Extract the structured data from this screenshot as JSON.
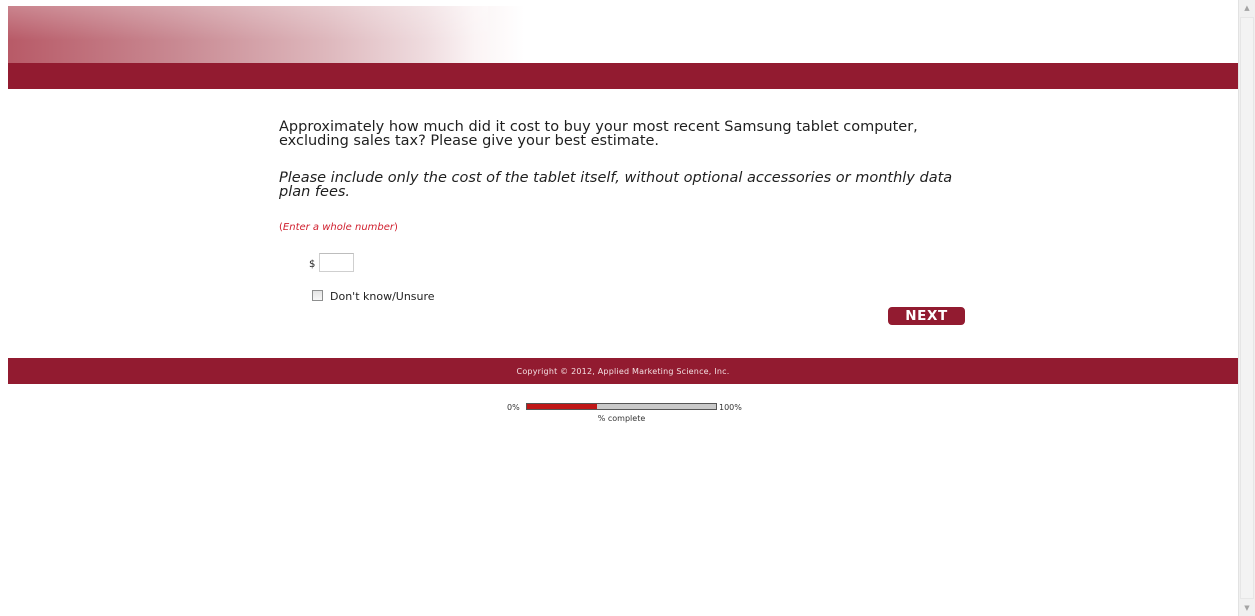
{
  "question": {
    "text": "Approximately how much did it cost to buy your most recent Samsung tablet computer, excluding sales tax? Please give your best estimate.",
    "instruction": "Please include only the cost of the tablet itself, without optional accessories or monthly data plan fees.",
    "hint_open": "(",
    "hint_text": "Enter a whole number",
    "hint_close": ")"
  },
  "answer": {
    "currency_symbol": "$",
    "amount_value": "",
    "dont_know_label": "Don't know/Unsure",
    "dont_know_checked": false
  },
  "navigation": {
    "next_label": "NEXT"
  },
  "footer": {
    "copyright": "Copyright © 2012, Applied Marketing Science, Inc."
  },
  "progress": {
    "start_label": "0%",
    "end_label": "100%",
    "caption": "% complete",
    "fraction_complete": 0.37
  },
  "colors": {
    "brand": "#921b30",
    "hint": "#d0202f",
    "progress_fill": "#c01717",
    "progress_track": "#c9c9c9"
  },
  "icons": {
    "scroll_up": "scroll-up-arrow-icon",
    "scroll_down": "scroll-down-arrow-icon"
  }
}
